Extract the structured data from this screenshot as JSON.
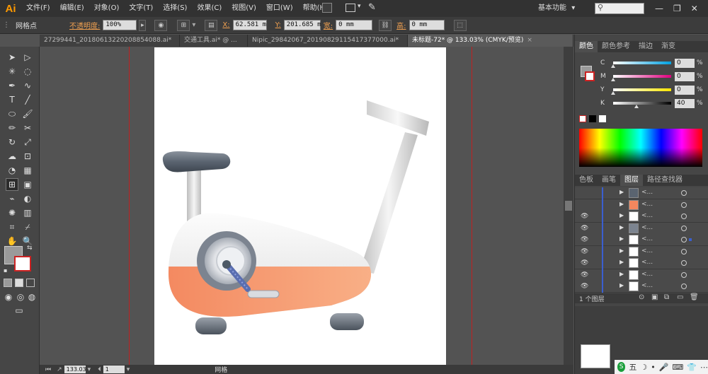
{
  "app": {
    "logo": "Ai",
    "menus": [
      "文件(F)",
      "编辑(E)",
      "对象(O)",
      "文字(T)",
      "选择(S)",
      "效果(C)",
      "视图(V)",
      "窗口(W)",
      "帮助(H)"
    ],
    "workspace": "基本功能",
    "workspace_arrow": "▾",
    "window_controls": [
      "—",
      "❐",
      "✕"
    ]
  },
  "control_bar": {
    "mode_label": "网格点",
    "opacity_label": "不透明度:",
    "opacity_value": "100%",
    "x_label": "X:",
    "x_value": "62.581 m",
    "y_label": "Y:",
    "y_value": "201.685 m",
    "width_label": "宽:",
    "width_value": "0 mm",
    "height_label": "高:",
    "height_value": "0 mm"
  },
  "doc_tabs": [
    {
      "label": "27299441_201806132202088540​88.ai*",
      "active": false
    },
    {
      "label": "交通工具.ai* @ ...",
      "active": false
    },
    {
      "label": "Nipic_29842067_20190829115417377000.ai*",
      "active": false
    },
    {
      "label": "未标题-72* @ 133.03% (CMYK/预览)",
      "active": true
    }
  ],
  "status_bar": {
    "zoom": "133.03",
    "page": "1",
    "mode": "网格"
  },
  "color_panel": {
    "tabs": [
      "颜色",
      "颜色参考",
      "描边",
      "渐变"
    ],
    "sliders": [
      {
        "label": "C",
        "value": "0",
        "unit": "%",
        "gradient": "linear-gradient(90deg,#fff,#00a0e0)",
        "pos": 0
      },
      {
        "label": "M",
        "value": "0",
        "unit": "%",
        "gradient": "linear-gradient(90deg,#fff,#e0007f)",
        "pos": 0
      },
      {
        "label": "Y",
        "value": "0",
        "unit": "%",
        "gradient": "linear-gradient(90deg,#fff,#ffe600)",
        "pos": 0
      },
      {
        "label": "K",
        "value": "40",
        "unit": "%",
        "gradient": "linear-gradient(90deg,#fff,#000)",
        "pos": 40
      }
    ]
  },
  "layers_panel": {
    "tabs": [
      "色板",
      "画笔",
      "图层",
      "路径查找器"
    ],
    "footer_text": "1 个图层"
  },
  "colors": {
    "bike_orange": "#f3875e",
    "bike_white": "#f0f0f0",
    "bike_gray": "#6b7480",
    "accent_orange": "#ff9a00"
  },
  "tray": {
    "ime": "五"
  }
}
